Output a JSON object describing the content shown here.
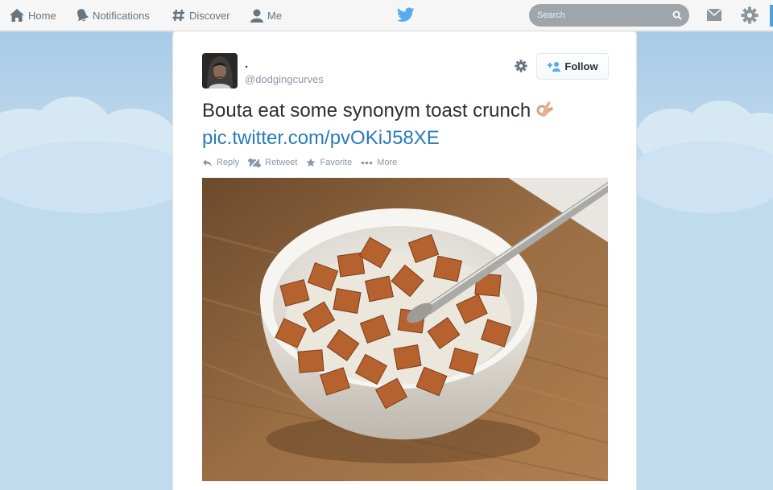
{
  "nav": {
    "home": "Home",
    "notifications": "Notifications",
    "discover": "Discover",
    "me": "Me"
  },
  "search": {
    "placeholder": "Search"
  },
  "tweet": {
    "fullname": ".",
    "username": "@dodgingcurves",
    "text": "Bouta eat some synonym toast crunch",
    "link": "pic.twitter.com/pvOKiJ58XE",
    "emoji": "ok-hand-emoji"
  },
  "follow_label": "Follow",
  "actions": {
    "reply": "Reply",
    "retweet": "Retweet",
    "favorite": "Favorite",
    "more": "More"
  },
  "colors": {
    "accent": "#55acee",
    "link": "#2b7bb9",
    "muted": "#8899a6",
    "sky": "#c0daee"
  },
  "icons": [
    "home-icon",
    "bell-icon",
    "hash-icon",
    "person-icon",
    "bird-logo-icon",
    "search-icon",
    "envelope-icon",
    "gear-icon",
    "add-user-icon",
    "reply-icon",
    "retweet-icon",
    "star-icon",
    "ellipsis-icon"
  ]
}
